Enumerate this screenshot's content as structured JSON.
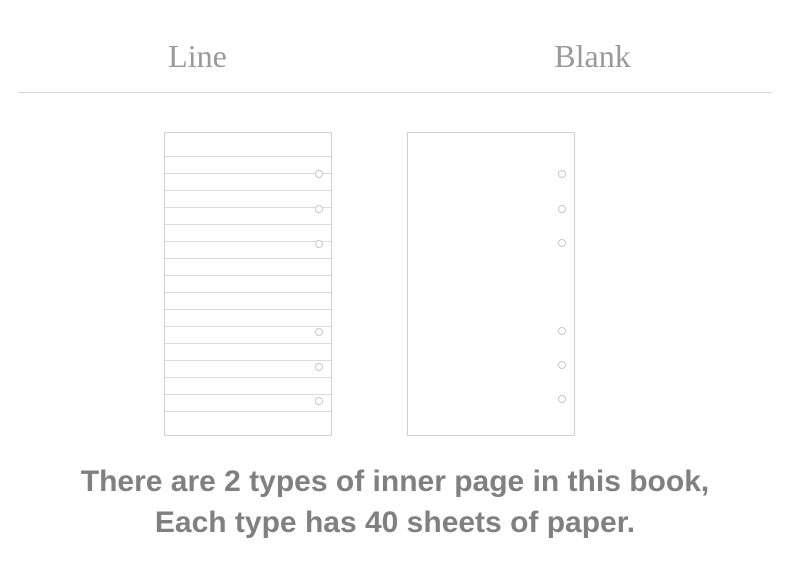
{
  "labels": {
    "line": "Line",
    "blank": "Blank"
  },
  "caption": {
    "line1": "There are 2 types of inner page in this book,",
    "line2": "Each type has 40 sheets of paper."
  },
  "page_types_count": 2,
  "sheets_per_type": 40
}
